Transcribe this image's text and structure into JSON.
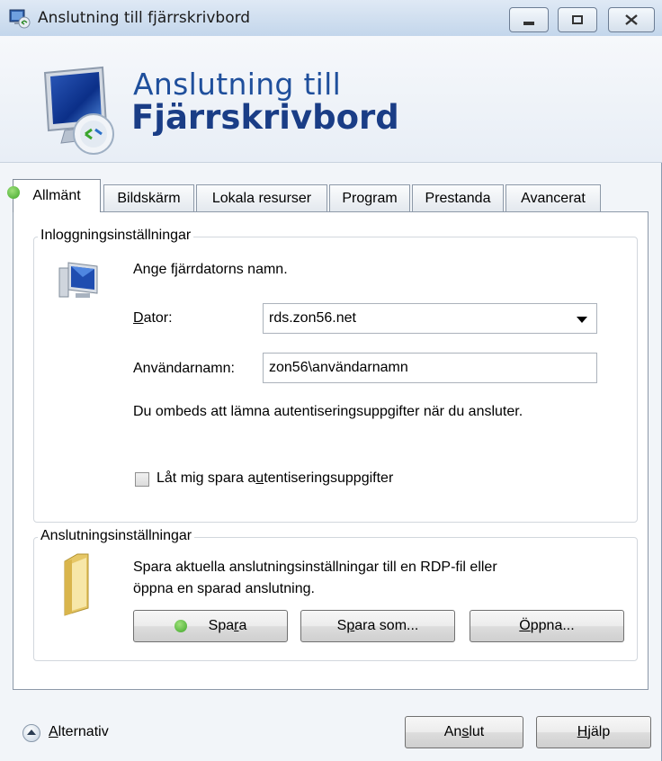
{
  "window": {
    "title": "Anslutning till fjärrskrivbord"
  },
  "banner": {
    "title_line1": "Anslutning till",
    "title_line2": "Fjärrskrivbord"
  },
  "tabs": [
    {
      "label": "Allmänt",
      "active": true
    },
    {
      "label": "Bildskärm",
      "active": false
    },
    {
      "label": "Lokala resurser",
      "active": false
    },
    {
      "label": "Program",
      "active": false
    },
    {
      "label": "Prestanda",
      "active": false
    },
    {
      "label": "Avancerat",
      "active": false
    }
  ],
  "login": {
    "group_label": "Inloggningsinställningar",
    "intro": "Ange fjärrdatorns namn.",
    "computer_label": "Dator:",
    "computer_value": "rds.zon56.net",
    "username_label": "Användarnamn:",
    "username_value": "zon56\\användarnamn",
    "info": "Du ombeds att lämna autentiseringsuppgifter när du ansluter.",
    "save_credentials_label": "Låt mig spara autentiseringsuppgifter",
    "save_credentials_checked": false
  },
  "connection": {
    "group_label": "Anslutningsinställningar",
    "description_line1": "Spara aktuella anslutningsinställningar till en RDP-fil eller",
    "description_line2": "öppna en sparad anslutning.",
    "save_label": "Spara",
    "save_as_label": "Spara som...",
    "open_label": "Öppna..."
  },
  "footer": {
    "options_label": "Alternativ",
    "connect_label": "Anslut",
    "help_label": "Hjälp"
  },
  "colors": {
    "title_blue": "#1a3d86",
    "accent_green": "#3fa72a"
  },
  "icons": [
    "remote-desktop-icon",
    "computer-icon",
    "folder-icon",
    "chevron-up-icon",
    "minimize-icon",
    "maximize-icon",
    "close-icon"
  ]
}
